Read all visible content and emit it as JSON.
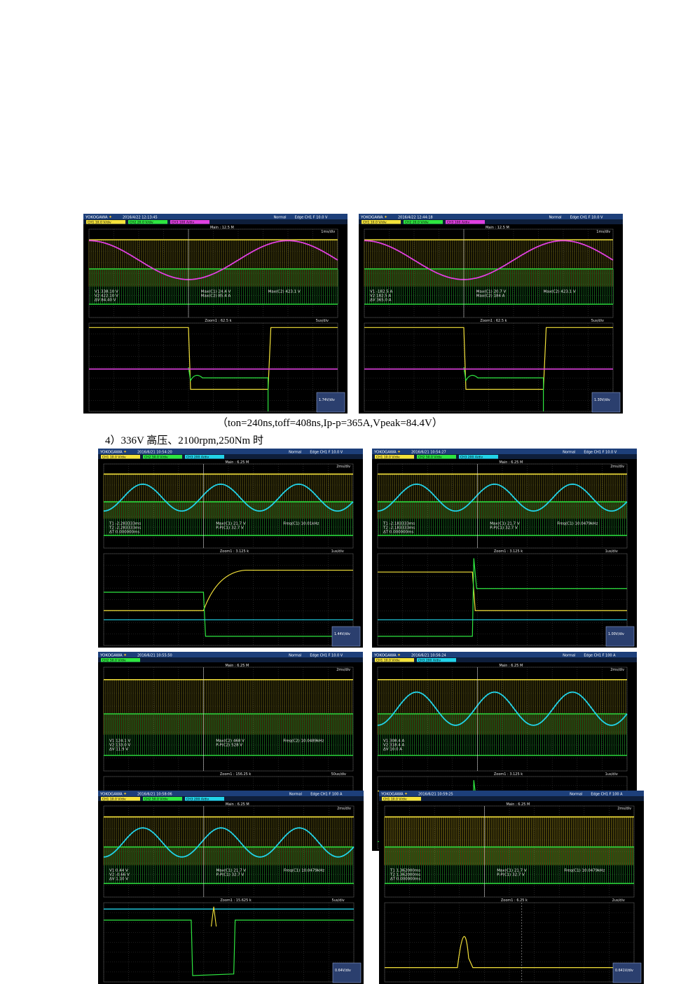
{
  "brand": "YOKOGAWA",
  "caption": "（ton=240ns,toff=408ns,Ip-p=365A,Vpeak=84.4V）",
  "section_heading": "4）336V 高压、2100rpm,250Nm 时",
  "scopes": [
    {
      "id": "s1",
      "timestamp": "2016/4/22 12:13:45",
      "mode": "Normal",
      "trigger": "Edge CH1 F 10.0 V",
      "main": "Main : 12.5 M",
      "div": "1ms/div",
      "zoom": "Zoom1 : 62.5 k",
      "zoom_div": "5us/div",
      "ch1": "CH1 10.0 V/div",
      "ch2": "CH2 20.0 V/div",
      "ch3": "CH3 100 A/div",
      "m1": "V1  338.10 V",
      "m2": "V2  422.10 V",
      "m3": "ΔV  84.40 V",
      "mx1": "Max(C1) 24.4 V",
      "mx2": "Max(C2) 85.4 A",
      "mx3": "Max(C2) 423.1 V",
      "corner": "1.74V/div"
    },
    {
      "id": "s2",
      "timestamp": "2016/4/22 12:44:18",
      "mode": "Normal",
      "trigger": "Edge CH1 F 10.0 V",
      "main": "Main : 12.5 M",
      "div": "1ms/div",
      "zoom": "Zoom1 : 62.5 k",
      "zoom_div": "5us/div",
      "ch1": "CH1 10.0 V/div",
      "ch2": "CH2 20.0 V/div",
      "ch3": "CH3 100 A/div",
      "m1": "V1  -182.5 A",
      "m2": "V2  182.5 A",
      "m3": "ΔV  365.0 A",
      "mx1": "Max(C1) 20.7 V",
      "mx2": "Max(C2) 184 A",
      "mx3": "Max(C2) 423.1 V",
      "corner": "1.30V/div"
    },
    {
      "id": "s3",
      "timestamp": "2016/6/21 10:54:20",
      "mode": "Normal",
      "trigger": "Edge CH1 F 10.0 V",
      "main": "Main : 6.25 M",
      "div": "2ms/div",
      "zoom": "Zoom1 : 3.125 k",
      "zoom_div": "1us/div",
      "ch1": "CH1 10.0 V/div",
      "ch2": "CH2 50.0 V/div",
      "ch3": "CH3 200 A/div",
      "m1": "T1  -2.283333ms",
      "m2": "T2  -2.283333ms",
      "m3": "ΔT  0.000000ms",
      "mx1": "Max(C1) 21.7 V",
      "mx2": "P-P(C1) 32.7 V",
      "mx3": "Freq(C1) 10.01kHz",
      "corner": "1.44V/div"
    },
    {
      "id": "s4",
      "timestamp": "2016/6/21 10:54:27",
      "mode": "Normal",
      "trigger": "Edge CH1 F 10.0 V",
      "main": "Main : 6.25 M",
      "div": "2ms/div",
      "zoom": "Zoom1 : 3.125 k",
      "zoom_div": "1us/div",
      "ch1": "CH1 10.0 V/div",
      "ch2": "CH2 50.0 V/div",
      "ch3": "CH3 200 A/div",
      "m1": "T1  -2.183333ms",
      "m2": "T2  -2.183333ms",
      "m3": "ΔT  0.000000ms",
      "mx1": "Max(C1) 21.7 V",
      "mx2": "P-P(C1) 32.7 V",
      "mx3": "Freq(C1) 10.0479kHz",
      "corner": "1.00V/div"
    },
    {
      "id": "s5",
      "timestamp": "2016/6/21 10:55:50",
      "mode": "Normal",
      "trigger": "Edge CH1 F 10.0 V",
      "main": "Main : 6.25 M",
      "div": "2ms/div",
      "zoom": "Zoom1 : 156.25 k",
      "zoom_div": "50us/div",
      "ch1": "",
      "ch2": "CH2 50.0 V/div",
      "ch3": "",
      "m1": "V1  124.1 V",
      "m2": "V2  133.0 V",
      "m3": "ΔV  11.9 V",
      "mx1": "Max(C2) 468 V",
      "mx2": "P-P(C2) 528 V",
      "mx3": "Freq(C2) 10.0489kHz",
      "corner": ""
    },
    {
      "id": "s6",
      "timestamp": "2016/6/21 10:56:24",
      "mode": "Normal",
      "trigger": "Edge CH1 F 100 A",
      "main": "Main : 6.25 M",
      "div": "2ms/div",
      "zoom": "Zoom1 : 3.125 k",
      "zoom_div": "1us/div",
      "ch1": "CH1 10.0 V/div",
      "ch2": "",
      "ch3": "CH3 200 A/div",
      "m1": "V1  308.4 A",
      "m2": "V2  318.4 A",
      "m3": "ΔV  10.0 A",
      "mx1": "",
      "mx2": "",
      "mx3": "",
      "corner": ""
    },
    {
      "id": "s7",
      "timestamp": "2016/6/21 10:58:06",
      "mode": "Normal",
      "trigger": "Edge CH1 F 100 A",
      "main": "Main : 6.25 M",
      "div": "2ms/div",
      "zoom": "Zoom1 : 15.625 k",
      "zoom_div": "5us/div",
      "ch1": "CH1 10.0 V/div",
      "ch2": "CH2 50.0 V/div",
      "ch3": "CH3 200 A/div",
      "m1": "V1  0.44 V",
      "m2": "V2  -0.66 V",
      "m3": "ΔV  1.10 V",
      "mx1": "Max(C1) 21.7 V",
      "mx2": "P-P(C1) 32.7 V",
      "mx3": "Freq(C1) 10.0479kHz",
      "corner": "0.64V/div"
    },
    {
      "id": "s8",
      "timestamp": "2016/6/21 10:59:25",
      "mode": "Normal",
      "trigger": "Edge CH1 F 100 A",
      "main": "Main : 6.25 M",
      "div": "2ms/div",
      "zoom": "Zoom1 : 6.25 k",
      "zoom_div": "2us/div",
      "ch1": "CH1 10.0 V/div",
      "ch2": "",
      "ch3": "",
      "m1": "T1  1.362000ms",
      "m2": "T2  1.362000ms",
      "m3": "ΔT  0.000000ms",
      "mx1": "Max(C1) 21.7 V",
      "mx2": "P-P(C1) 32.7 V",
      "mx3": "Freq(C1) 10.0479kHz",
      "corner": "0.641V/div"
    }
  ]
}
